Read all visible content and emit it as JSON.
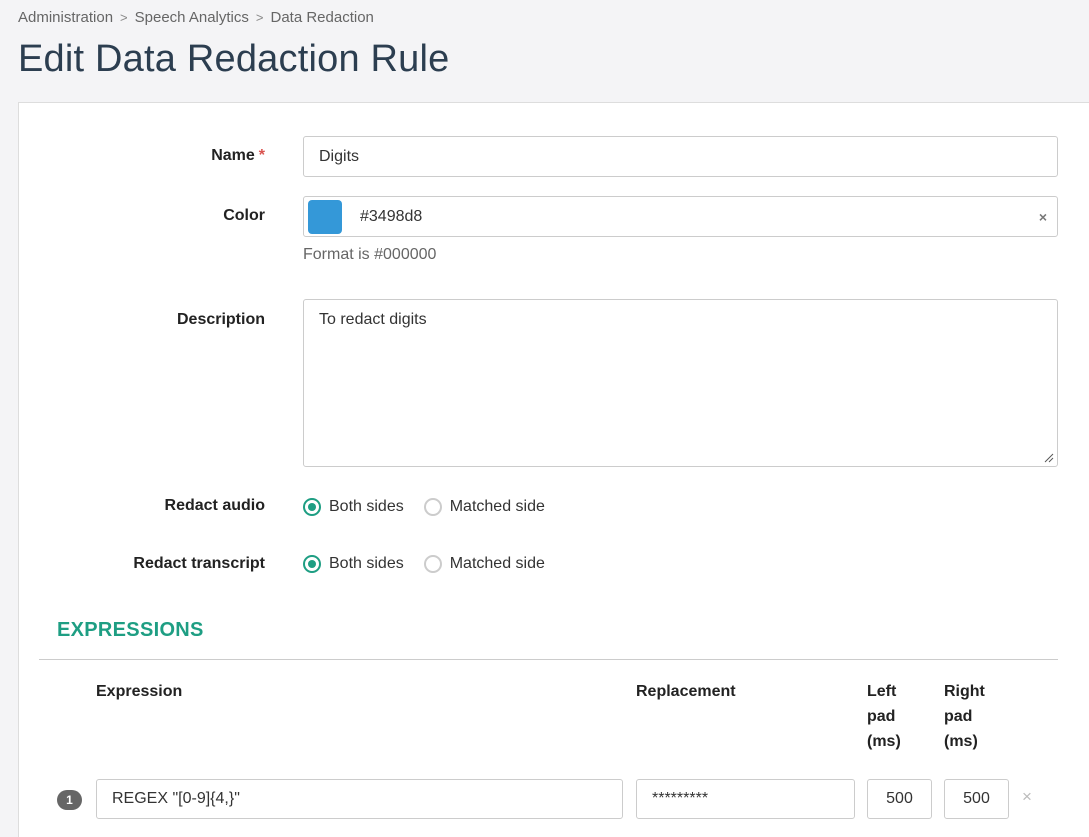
{
  "breadcrumb": [
    "Administration",
    "Speech Analytics",
    "Data Redaction"
  ],
  "page_title": "Edit Data Redaction Rule",
  "form": {
    "name": {
      "label": "Name",
      "required_mark": "*",
      "value": "Digits"
    },
    "color": {
      "label": "Color",
      "value": "#3498d8",
      "swatch": "#3498d8",
      "clear_icon": "×",
      "help": "Format is #000000"
    },
    "description": {
      "label": "Description",
      "value": "To redact digits"
    },
    "redact_audio": {
      "label": "Redact audio",
      "options": [
        "Both sides",
        "Matched side"
      ],
      "selected": "Both sides"
    },
    "redact_transcript": {
      "label": "Redact transcript",
      "options": [
        "Both sides",
        "Matched side"
      ],
      "selected": "Both sides"
    }
  },
  "expressions": {
    "title": "EXPRESSIONS",
    "columns": {
      "expression": "Expression",
      "replacement": "Replacement",
      "left_pad": "Left pad (ms)",
      "right_pad": "Right pad (ms)"
    },
    "rows": [
      {
        "index": "1",
        "expression": "REGEX \"[0-9]{4,}\"",
        "replacement": "*********",
        "left_pad": "500",
        "right_pad": "500",
        "remove_icon": "×"
      }
    ]
  },
  "colors": {
    "accent": "#1e9e83",
    "title": "#2c3e50",
    "required": "#d9534f"
  }
}
